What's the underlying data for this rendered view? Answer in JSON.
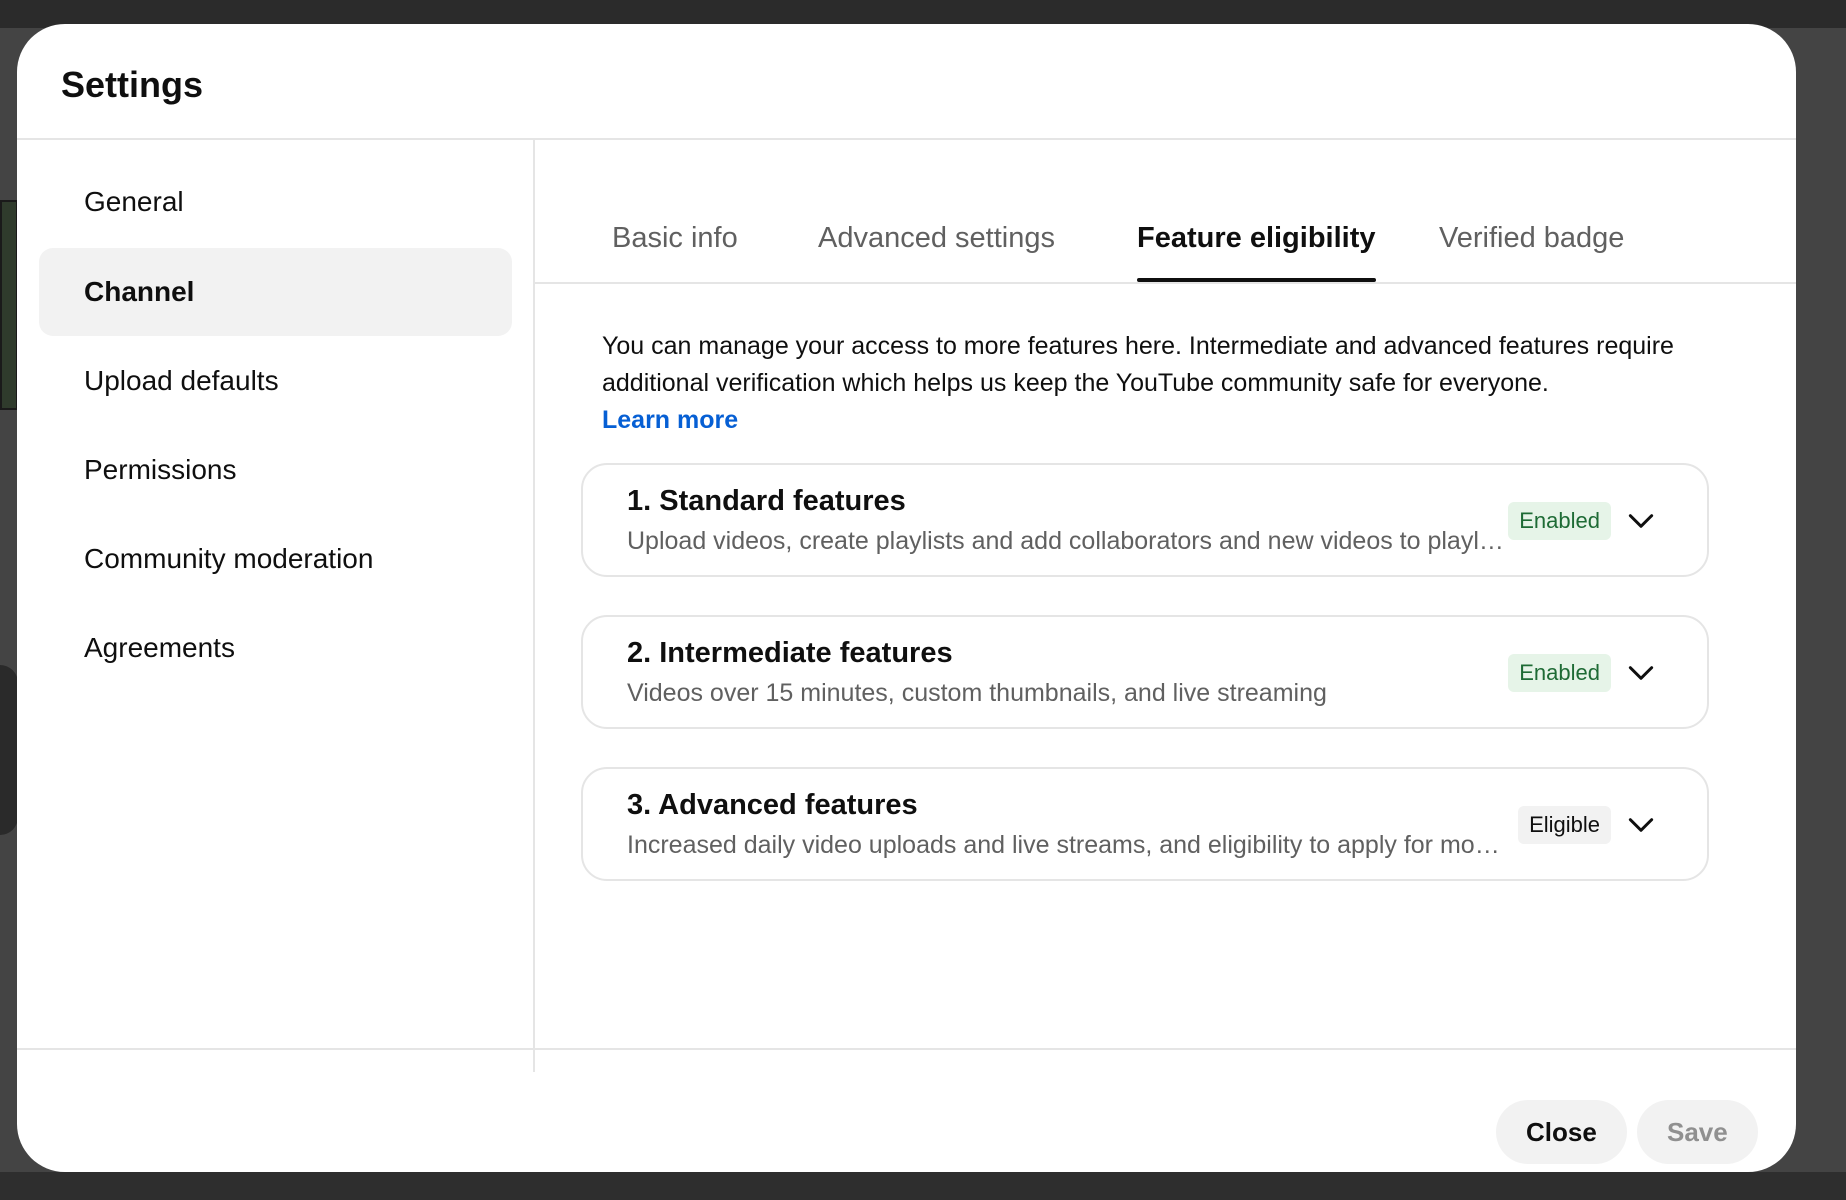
{
  "dialog": {
    "title": "Settings"
  },
  "sidebar": {
    "items": [
      {
        "label": "General",
        "active": false
      },
      {
        "label": "Channel",
        "active": true
      },
      {
        "label": "Upload defaults",
        "active": false
      },
      {
        "label": "Permissions",
        "active": false
      },
      {
        "label": "Community moderation",
        "active": false
      },
      {
        "label": "Agreements",
        "active": false
      }
    ]
  },
  "tabs": [
    {
      "label": "Basic info",
      "active": false
    },
    {
      "label": "Advanced settings",
      "active": false
    },
    {
      "label": "Feature eligibility",
      "active": true
    },
    {
      "label": "Verified badge",
      "active": false
    }
  ],
  "content": {
    "intro_text": "You can manage your access to more features here. Intermediate and advanced features require additional verification which helps us keep the YouTube community safe for everyone.",
    "learn_more": "Learn more",
    "features": [
      {
        "title": "1. Standard features",
        "description": "Upload videos, create playlists and add collaborators and new videos to playlists",
        "status": "Enabled",
        "chevron_icon": "chevron-down-icon"
      },
      {
        "title": "2. Intermediate features",
        "description": "Videos over 15 minutes, custom thumbnails, and live streaming",
        "status": "Enabled",
        "chevron_icon": "chevron-down-icon"
      },
      {
        "title": "3. Advanced features",
        "description": "Increased daily video uploads and live streams, and eligibility to apply for monetization",
        "status": "Eligible",
        "chevron_icon": "chevron-down-icon"
      }
    ]
  },
  "footer": {
    "close_label": "Close",
    "save_label": "Save"
  },
  "colors": {
    "link": "#065fd4",
    "enabled_badge_bg": "#e6f4e8",
    "enabled_badge_text": "#1e6b35",
    "eligible_badge_bg": "#f2f2f2",
    "active_nav_bg": "#f2f2f2"
  }
}
